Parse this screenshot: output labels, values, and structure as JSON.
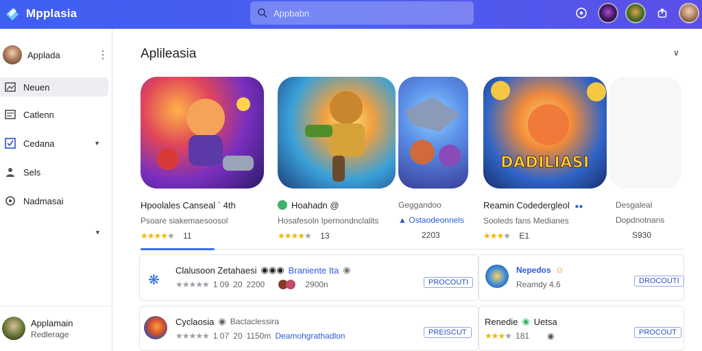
{
  "app": {
    "name": "Mpplasia"
  },
  "search": {
    "placeholder": "Appbabn"
  },
  "sidebar": {
    "profile_name": "Applada",
    "items": [
      {
        "label": "Neuen",
        "icon": "image-icon"
      },
      {
        "label": "Catlenn",
        "icon": "keyboard-icon"
      },
      {
        "label": "Cedana",
        "icon": "checkbox-icon"
      },
      {
        "label": "Sels",
        "icon": "people-icon"
      },
      {
        "label": "Nadmasai",
        "icon": "chat-icon"
      }
    ],
    "user": {
      "name": "Applamain",
      "subtitle": "Redlerage"
    }
  },
  "section": {
    "title": "Aplileasia"
  },
  "featured": [
    {
      "title": "Hpoolales Canseal ´ 4th",
      "subtitle": "Psoare siakemaesoosol",
      "rating_text": "11"
    },
    {
      "title": "Hoahadn @",
      "subtitle": "Hosafesoln Ipernondnclalits",
      "rating_text": "13"
    },
    {
      "title": "Geggandoo",
      "subtitle": "Ostaodeonnels",
      "rating_text": "2203"
    },
    {
      "title": "Reamin Codedergleol",
      "subtitle": "Sooleds fans Medianes",
      "rating_text": "E1",
      "art_text": "DADILIASI"
    },
    {
      "title": "Desgaleal",
      "subtitle": "Dopdnotnans",
      "rating_text": "S930"
    }
  ],
  "list": [
    {
      "title": "Clalusoon Zetahaesi",
      "extra": "Braniente Ita",
      "rating": "1 09",
      "count": "20",
      "size": "2200",
      "size2": "2900n",
      "button": "PROCOUTI"
    },
    {
      "title": "Nepedos",
      "subtitle": "Reamdy 4.6",
      "button": "DROCOUTI"
    },
    {
      "title": "Cyclaosia",
      "extra": "Bactaclessira",
      "rating": "1 07",
      "count": "20",
      "size": "1150m",
      "link": "Deamohgrathadlon",
      "button": "PREISCUT"
    },
    {
      "title": "Renedie",
      "extra": "Uetsa",
      "rating": "181",
      "button": "PROCOUT"
    }
  ],
  "colors": {
    "topbar": "#4a5ef0",
    "accent": "#3f6bea",
    "star": "#f4b400"
  }
}
